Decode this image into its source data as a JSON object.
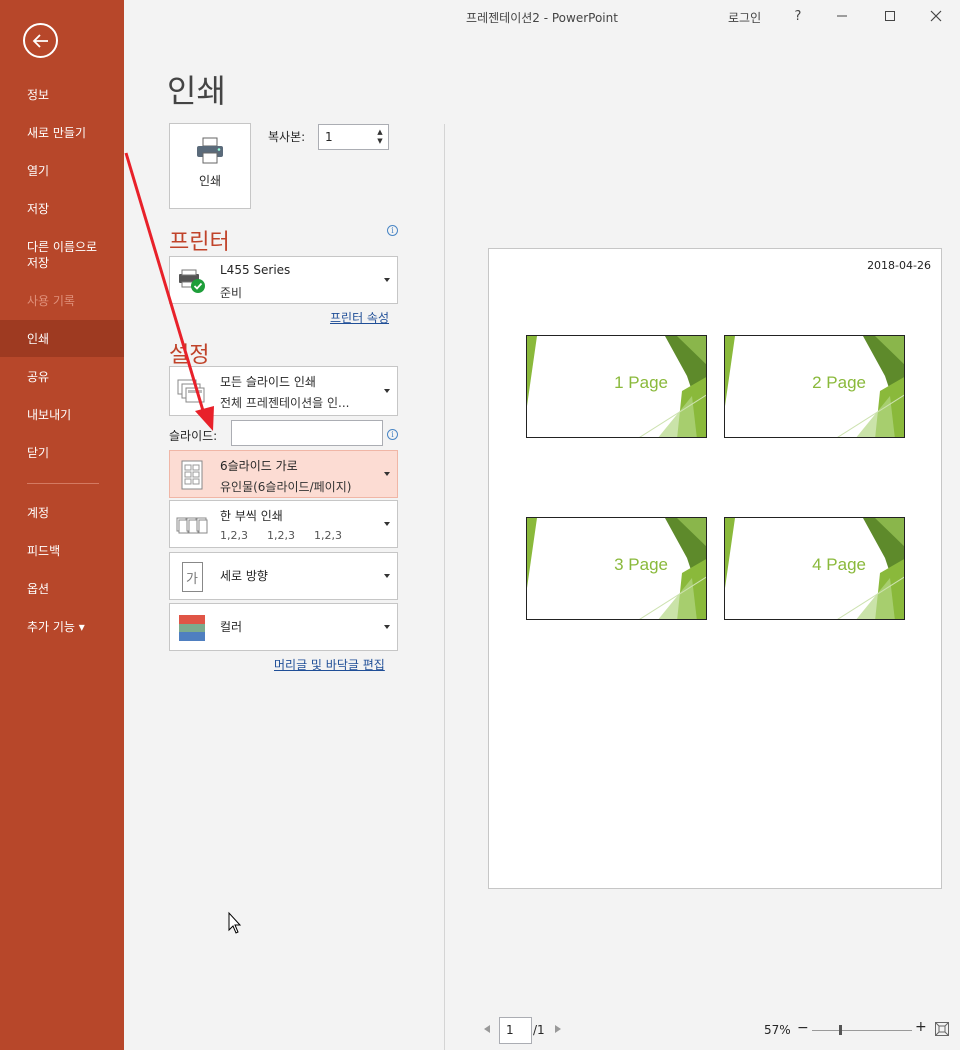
{
  "window": {
    "title": "프레젠테이션2  -  PowerPoint",
    "login": "로그인",
    "help": "?"
  },
  "sidebar": {
    "items": [
      {
        "label": "정보"
      },
      {
        "label": "새로 만들기"
      },
      {
        "label": "열기"
      },
      {
        "label": "저장"
      },
      {
        "label": "다른 이름으로 저장"
      },
      {
        "label": "사용 기록"
      },
      {
        "label": "인쇄"
      },
      {
        "label": "공유"
      },
      {
        "label": "내보내기"
      },
      {
        "label": "닫기"
      },
      {
        "label": "계정"
      },
      {
        "label": "피드백"
      },
      {
        "label": "옵션"
      },
      {
        "label": "추가 기능 ▾"
      }
    ]
  },
  "print": {
    "page_title": "인쇄",
    "print_button": "인쇄",
    "copies_label": "복사본:",
    "copies_value": "1"
  },
  "printer": {
    "section_title": "프린터",
    "name": "L455 Series",
    "status": "준비",
    "properties_link": "프린터 속성"
  },
  "settings": {
    "section_title": "설정",
    "range_title": "모든 슬라이드 인쇄",
    "range_sub": "전체 프레젠테이션을 인...",
    "slides_label": "슬라이드:",
    "slides_value": "",
    "layout_title": "6슬라이드 가로",
    "layout_sub": "유인물(6슬라이드/페이지)",
    "collate_title": "한 부씩 인쇄",
    "collate_sub": [
      "1,2,3",
      "1,2,3",
      "1,2,3"
    ],
    "orientation_title": "세로 방향",
    "orientation_glyph": "가",
    "color_title": "컬러",
    "header_footer_link": "머리글 및 바닥글 편집"
  },
  "preview": {
    "date": "2018-04-26",
    "slides": [
      "1 Page",
      "2 Page",
      "3 Page",
      "4 Page"
    ],
    "page_number": "1",
    "page_total": "/1",
    "zoom": "57%",
    "zoom_fraction": 0.28
  },
  "colors": {
    "accent": "#b7472a",
    "accent_active": "#9e3a21",
    "slide_green": "#8ab93b",
    "section_red": "#c0432a"
  }
}
